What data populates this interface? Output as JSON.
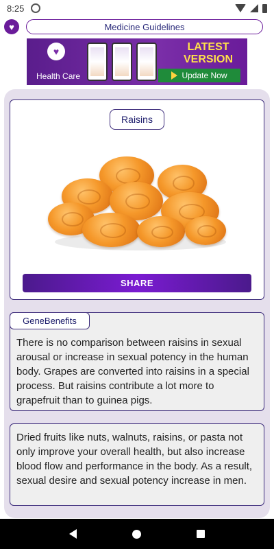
{
  "status_bar": {
    "time": "8:25"
  },
  "app_bar": {
    "title": "Medicine Guidelines"
  },
  "banner": {
    "label": "Health Care",
    "headline_line1": "LATEST",
    "headline_line2": "VERSION",
    "cta": "Update Now"
  },
  "item": {
    "name": "Raisins",
    "share_label": "SHARE"
  },
  "benefits": {
    "heading": "GeneBenefits",
    "paragraph1": "There is no comparison between raisins in sexual arousal or increase in sexual potency in the human body. Grapes are converted into raisins in a special process. But raisins contribute a lot more to grapefruit than to guinea pigs.",
    "paragraph2": "Dried fruits like nuts, walnuts, raisins, or pasta not only improve your overall health, but also increase blood flow and performance in the body. As a result, sexual desire and sexual potency increase in men."
  },
  "colors": {
    "accent": "#6a1b9a",
    "share_button": "#7a1bd1",
    "update_button": "#1f8b3a",
    "banner_headline": "#ffe14a"
  },
  "icons": {
    "status_left": "at-sign-icon",
    "wifi": "wifi-icon",
    "signal": "signal-icon",
    "battery": "battery-icon",
    "app_logo": "heart-logo-icon",
    "nav_back": "back-icon",
    "nav_home": "home-icon",
    "nav_recent": "recent-apps-icon"
  }
}
